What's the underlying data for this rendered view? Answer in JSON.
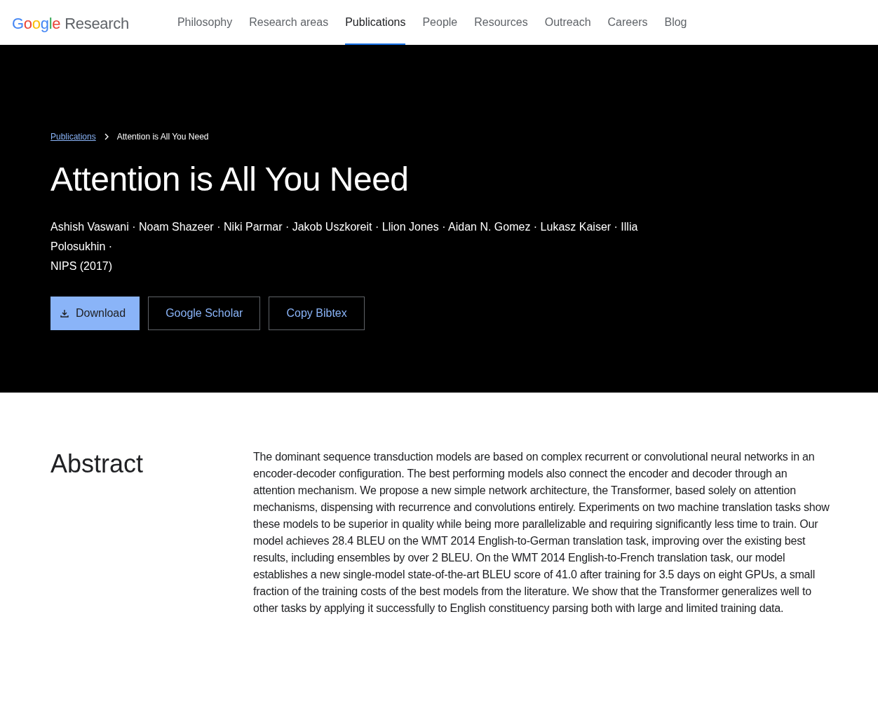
{
  "logo": {
    "letters": [
      {
        "text": "G",
        "color": "#4285f4"
      },
      {
        "text": "o",
        "color": "#ea4335"
      },
      {
        "text": "o",
        "color": "#fbbc04"
      },
      {
        "text": "g",
        "color": "#4285f4"
      },
      {
        "text": "l",
        "color": "#34a853"
      },
      {
        "text": "e",
        "color": "#ea4335"
      }
    ],
    "product": "Research"
  },
  "nav": [
    {
      "label": "Philosophy",
      "selected": false
    },
    {
      "label": "Research areas",
      "selected": false
    },
    {
      "label": "Publications",
      "selected": true
    },
    {
      "label": "People",
      "selected": false
    },
    {
      "label": "Resources",
      "selected": false
    },
    {
      "label": "Outreach",
      "selected": false
    },
    {
      "label": "Careers",
      "selected": false
    },
    {
      "label": "Blog",
      "selected": false
    }
  ],
  "breadcrumb": {
    "parent": "Publications",
    "current": "Attention is All You Need"
  },
  "title": "Attention is All You Need",
  "authors": "Ashish Vaswani · Noam Shazeer · Niki Parmar · Jakob Uszkoreit · Llion Jones · Aidan N. Gomez · Lukasz Kaiser · Illia Polosukhin ·",
  "venue": "NIPS (2017)",
  "buttons": [
    {
      "label": "Download",
      "kind": "filled"
    },
    {
      "label": "Google Scholar",
      "kind": "outlined"
    },
    {
      "label": "Copy Bibtex",
      "kind": "outlined"
    }
  ],
  "abstract": {
    "heading": "Abstract",
    "text": "The dominant sequence transduction models are based on complex recurrent or convolutional neural networks in an encoder-decoder configuration. The best performing models also connect the encoder and decoder through an attention mechanism. We propose a new simple network architecture, the Transformer, based solely on attention mechanisms, dispensing with recurrence and convolutions entirely. Experiments on two machine translation tasks show these models to be superior in quality while being more parallelizable and requiring significantly less time to train. Our model achieves 28.4 BLEU on the WMT 2014 English-to-German translation task, improving over the existing best results, including ensembles by over 2 BLEU. On the WMT 2014 English-to-French translation task, our model establishes a new single-model state-of-the-art BLEU score of 41.0 after training for 3.5 days on eight GPUs, a small fraction of the training costs of the best models from the literature. We show that the Transformer generalizes well to other tasks by applying it successfully to English constituency parsing both with large and limited training data."
  }
}
